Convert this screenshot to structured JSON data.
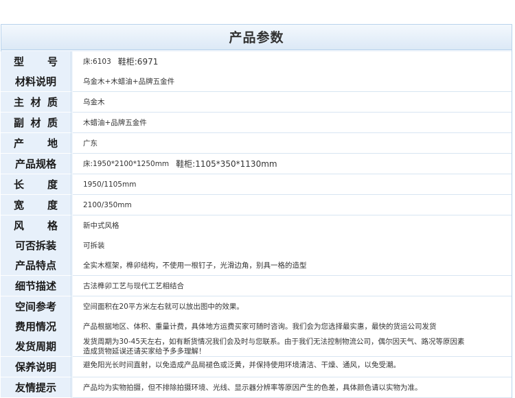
{
  "title": "产品参数",
  "rows": [
    {
      "label": "型号",
      "value": "床:6103",
      "extra": "鞋柜:6971"
    },
    {
      "label": "材料说明",
      "value": "乌金木+木蜡油+品牌五金件"
    },
    {
      "label": "主材质",
      "value": "乌金木"
    },
    {
      "label": "副材质",
      "value": "木蜡油+品牌五金件"
    },
    {
      "label": "产地",
      "value": "广东"
    },
    {
      "label": "产品规格",
      "value": "床:1950*2100*1250mm",
      "extra": "鞋柜:1105*350*1130mm"
    },
    {
      "label": "长度",
      "value": "1950/1105mm"
    },
    {
      "label": "宽度",
      "value": "2100/350mm"
    },
    {
      "label": "风格",
      "value": "新中式风格"
    },
    {
      "label": "可否拆装",
      "value": "可拆装"
    },
    {
      "label": "产品特点",
      "value": "全实木框架，榫卯结构，不使用一根钉子，光滑边角，别具一格的造型"
    },
    {
      "label": "细节描述",
      "value": "古法榫卯工艺与现代工艺相结合"
    },
    {
      "label": "空间参考",
      "value": "空间面积在20平方米左右就可以放出图中的效果。"
    },
    {
      "label": "费用情况",
      "value": "产品根据地区、体积、重量计费，具体地方运费买家可随时咨询。我们会为您选择最实惠，最快的货运公司发货"
    },
    {
      "label": "发货周期",
      "value": "发货周期为30-45天左右，如有断货情况我们会及时与您联系。由于我们无法控制物流公司，偶尔因天气、路况等原因素",
      "line2": "造成货物延误还请买家给予多多理解！"
    },
    {
      "label": "保养说明",
      "value": "避免阳光长时间直射，以免造成产品局褪色或泛黄，并保持使用环境清洁、干燥、通风，以免受潮。"
    },
    {
      "label": "友情提示",
      "value": "产品均为实物拍摄，但不排除拍摄环境、光线、显示器分辨率等原因产生的色差，具体颜色请以实物为准。"
    }
  ]
}
